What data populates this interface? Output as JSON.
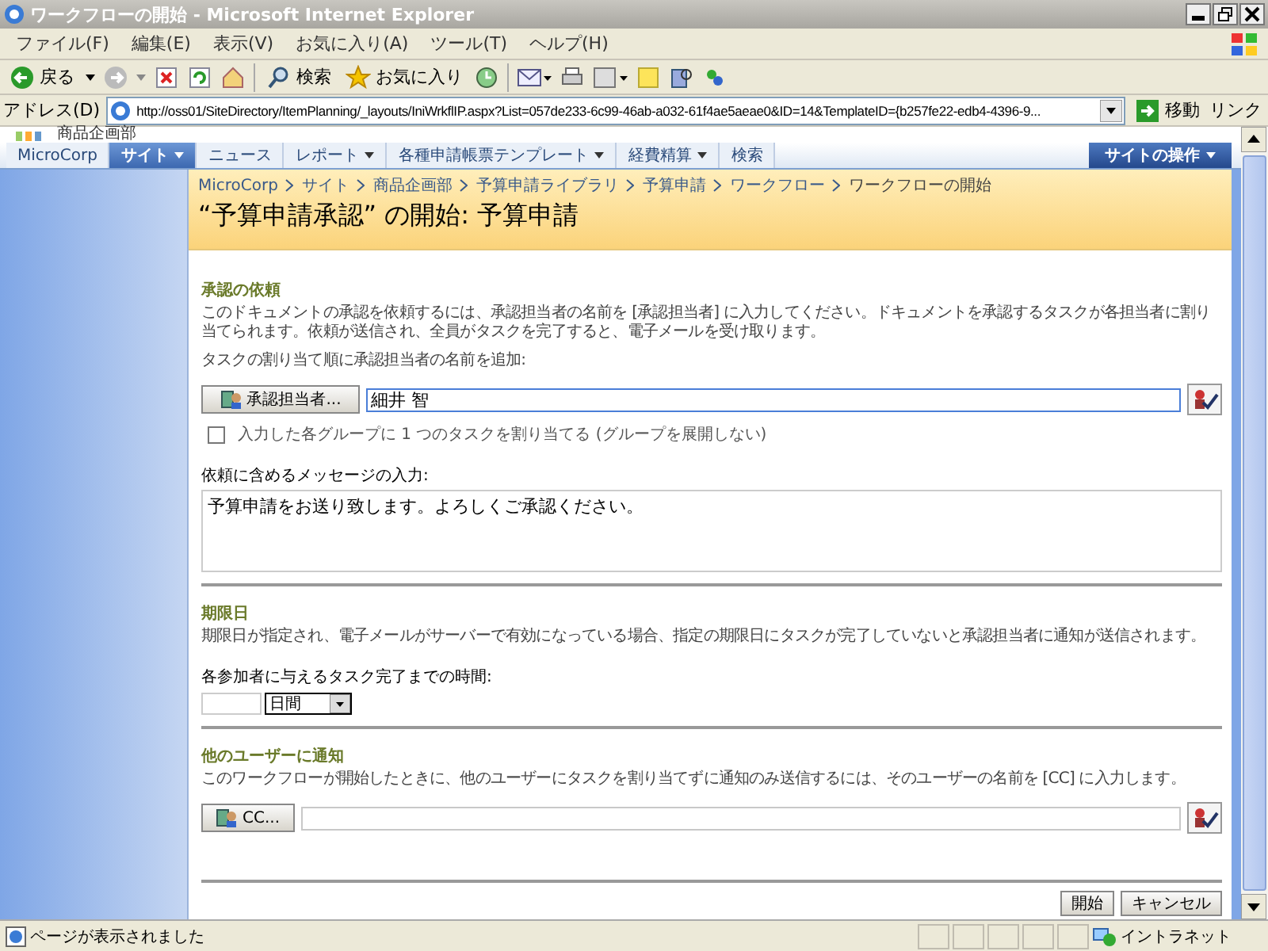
{
  "window": {
    "title": "ワークフローの開始 - Microsoft Internet Explorer"
  },
  "menu": [
    "ファイル(F)",
    "編集(E)",
    "表示(V)",
    "お気に入り(A)",
    "ツール(T)",
    "ヘルプ(H)"
  ],
  "toolbar": {
    "back": "戻る",
    "search": "検索",
    "favorites": "お気に入り"
  },
  "address": {
    "label": "アドレス(D)",
    "url": "http://oss01/SiteDirectory/ItemPlanning/_layouts/IniWrkflIP.aspx?List=057de233-6c99-46ab-a032-61f4ae5aeae0&ID=14&TemplateID={b257fe22-edb4-4396-9...",
    "go": "移動",
    "links": "リンク"
  },
  "site_title": "商品企画部",
  "nav": [
    {
      "label": "MicroCorp",
      "selected": false,
      "dropdown": false
    },
    {
      "label": "サイト",
      "selected": true,
      "dropdown": true
    },
    {
      "label": "ニュース",
      "selected": false,
      "dropdown": false
    },
    {
      "label": "レポート",
      "selected": false,
      "dropdown": true
    },
    {
      "label": "各種申請帳票テンプレート",
      "selected": false,
      "dropdown": true
    },
    {
      "label": "経費精算",
      "selected": false,
      "dropdown": true
    },
    {
      "label": "検索",
      "selected": false,
      "dropdown": false
    }
  ],
  "site_actions": "サイトの操作",
  "breadcrumb": [
    "MicroCorp",
    "サイト",
    "商品企画部",
    "予算申請ライブラリ",
    "予算申請",
    "ワークフロー",
    "ワークフローの開始"
  ],
  "page_title": "“予算申請承認” の開始: 予算申請",
  "approval": {
    "heading": "承認の依頼",
    "description": "このドキュメントの承認を依頼するには、承認担当者の名前を [承認担当者] に入力してください。ドキュメントを承認するタスクが各担当者に割り当てられます。依頼が送信され、全員がタスクを完了すると、電子メールを受け取ります。",
    "prompt": "タスクの割り当て順に承認担当者の名前を追加:",
    "button": "承認担当者...",
    "value": "細井 智",
    "group_option": {
      "label": "入力した各グループに 1 つのタスクを割り当てる (グループを展開しない)",
      "checked": false
    },
    "message_label": "依頼に含めるメッセージの入力:",
    "message": "予算申請をお送り致します。よろしくご承認ください。"
  },
  "due": {
    "heading": "期限日",
    "description": "期限日が指定され、電子メールがサーバーで有効になっている場合、指定の期限日にタスクが完了していないと承認担当者に通知が送信されます。",
    "duration_label": "各参加者に与えるタスク完了までの時間:",
    "unit": "日間"
  },
  "notify": {
    "heading": "他のユーザーに通知",
    "description": "このワークフローが開始したときに、他のユーザーにタスクを割り当てずに通知のみ送信するには、そのユーザーの名前を [CC] に入力します。",
    "button": "CC..."
  },
  "actions": [
    "開始",
    "キャンセル"
  ],
  "status_bar": {
    "text": "ページが表示されました",
    "zone": "イントラネット"
  }
}
